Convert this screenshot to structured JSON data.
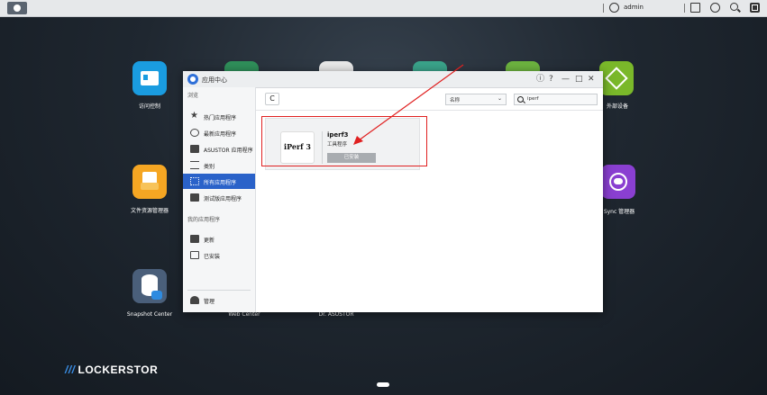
{
  "topbar": {
    "user": "admin"
  },
  "desktop": {
    "icons": [
      {
        "label": "访问控制"
      },
      {
        "label": "外部设备"
      },
      {
        "label": "文件资源管理器"
      },
      {
        "label": "Z Sync 管理器"
      },
      {
        "label": "Snapshot Center"
      },
      {
        "label": "Web Center"
      },
      {
        "label": "Dr. ASUSTOR"
      }
    ],
    "brand": "LOCKERSTOR"
  },
  "window": {
    "title": "应用中心",
    "controls": {
      "info": "ⓘ",
      "help": "?",
      "minimize": "—",
      "maximize": "□",
      "close": "✕"
    },
    "sidebar": {
      "browse_title": "浏览",
      "browse_items": [
        {
          "label": "热门应用程序"
        },
        {
          "label": "最新应用程序"
        },
        {
          "label": "ASUSTOR 应用程序"
        },
        {
          "label": "类别"
        },
        {
          "label": "所有应用程序"
        },
        {
          "label": "测试版应用程序"
        }
      ],
      "my_apps_title": "我的应用程序",
      "my_items": [
        {
          "label": "更新"
        },
        {
          "label": "已安装"
        }
      ],
      "manage_label": "管理"
    },
    "toolbar": {
      "refresh": "C",
      "sort_value": "名称",
      "sort_chevron": "⌄",
      "search_value": "iperf"
    },
    "app_card": {
      "logo_text": "iPerf 3",
      "name": "iperf3",
      "category": "工具程序",
      "button": "已安装"
    }
  },
  "colors": {
    "accent": "#2a62c9",
    "highlight": "#e02020"
  }
}
